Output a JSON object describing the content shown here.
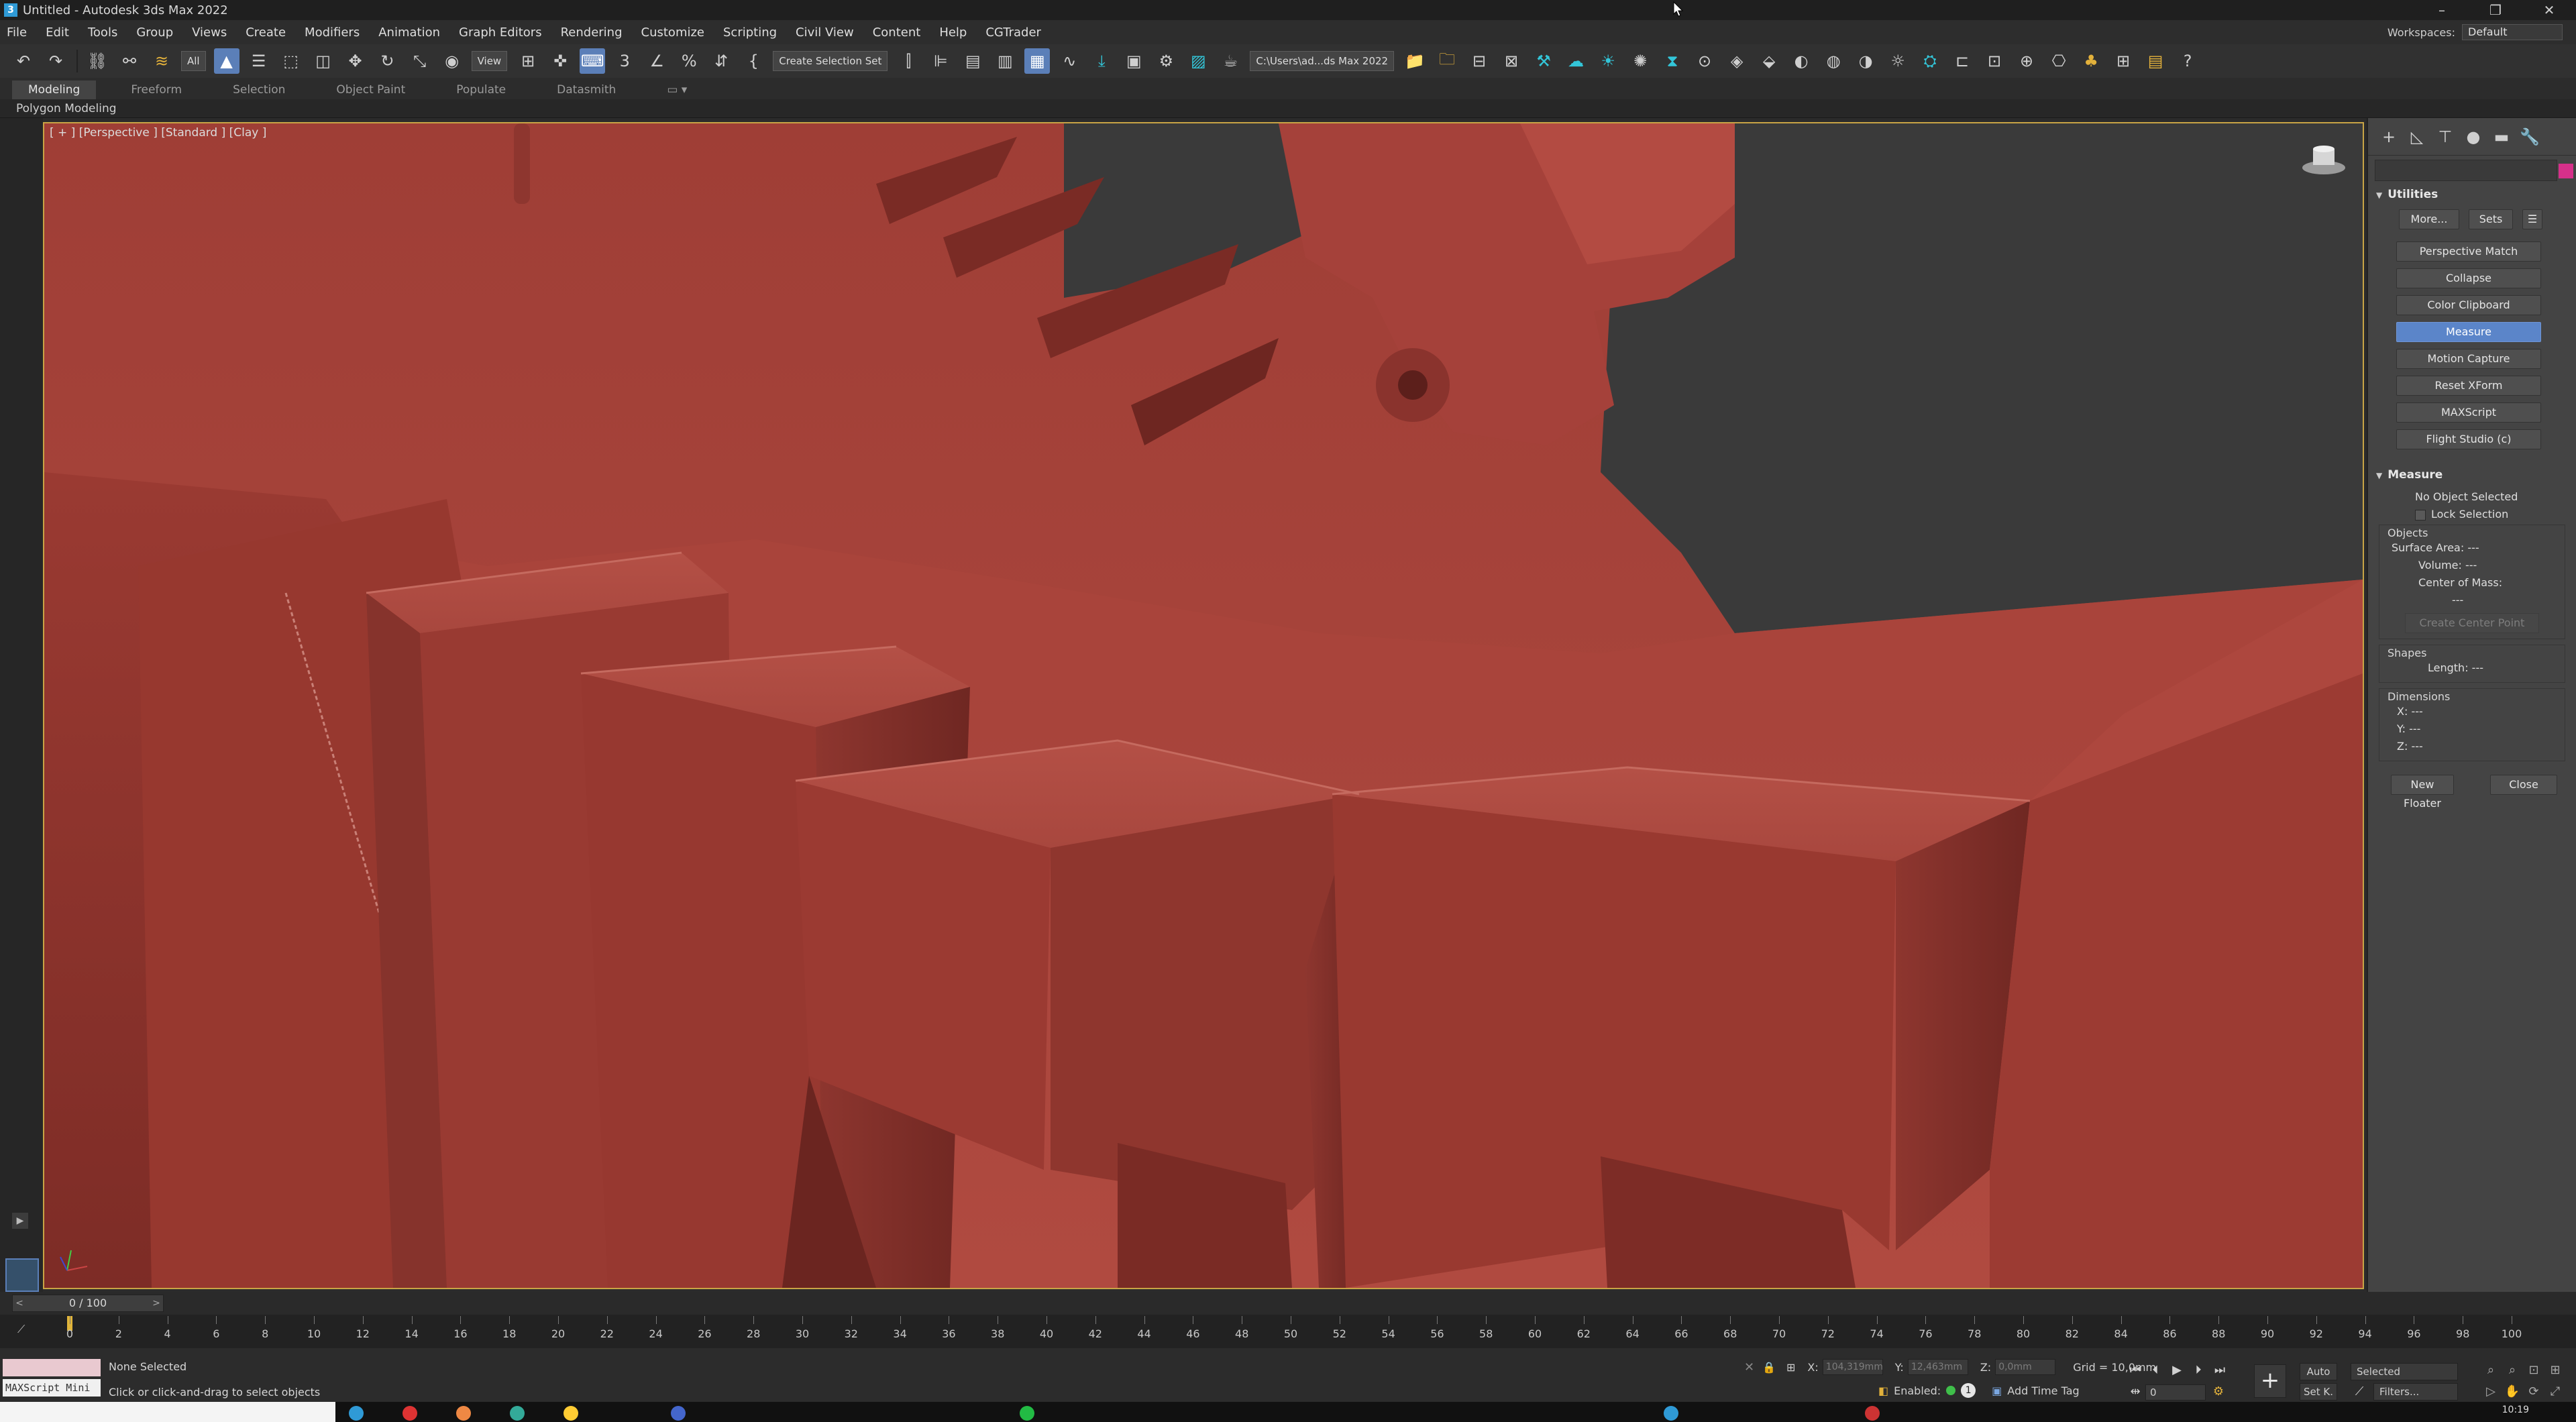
{
  "window": {
    "title": "Untitled - Autodesk 3ds Max 2022",
    "controls": [
      "–",
      "❐",
      "✕"
    ]
  },
  "menu": {
    "items": [
      "File",
      "Edit",
      "Tools",
      "Group",
      "Views",
      "Create",
      "Modifiers",
      "Animation",
      "Graph Editors",
      "Rendering",
      "Customize",
      "Scripting",
      "Civil View",
      "Content",
      "Help",
      "CGTrader"
    ],
    "workspaces_label": "Workspaces:",
    "workspace_value": "Default"
  },
  "toolbar": {
    "filter_value": "All",
    "refcoord_value": "View",
    "selection_set": "Create Selection Set",
    "project_path": "C:\\Users\\ad...ds Max 2022"
  },
  "ribbon": {
    "tabs": [
      "Modeling",
      "Freeform",
      "Selection",
      "Object Paint",
      "Populate",
      "Datasmith"
    ],
    "active_tab": "Modeling",
    "sub_label": "Polygon Modeling"
  },
  "viewport": {
    "label": "[ + ] [Perspective ] [Standard ] [Clay ]",
    "clay_color": "#a9433b",
    "background": "#3a3a3a"
  },
  "command_panel": {
    "rollout_utilities": "Utilities",
    "more_button": "More...",
    "sets_button": "Sets",
    "utilities": [
      "Perspective Match",
      "Collapse",
      "Color Clipboard",
      "Measure",
      "Motion Capture",
      "Reset XForm",
      "MAXScript",
      "Flight Studio (c)"
    ],
    "active_utility": "Measure",
    "rollout_measure": "Measure",
    "no_selection": "No Object Selected",
    "lock_selection": "Lock Selection",
    "objects_title": "Objects",
    "surface_area": "Surface Area:  ---",
    "volume": "Volume:  ---",
    "center_of_mass": "Center of Mass:",
    "center_value": "---",
    "create_center_point": "Create Center Point",
    "shapes_title": "Shapes",
    "length": "Length:  ---",
    "dimensions_title": "Dimensions",
    "dim_x": "X:  ---",
    "dim_y": "Y:  ---",
    "dim_z": "Z:  ---",
    "new_floater": "New Floater",
    "close": "Close",
    "accent_swatch": "#d6308a"
  },
  "timeline": {
    "slider_label": "0 / 100",
    "current_frame": 0,
    "ticks": [
      0,
      2,
      4,
      6,
      8,
      10,
      12,
      14,
      16,
      18,
      20,
      22,
      24,
      26,
      28,
      30,
      32,
      34,
      36,
      38,
      40,
      42,
      44,
      46,
      48,
      50,
      52,
      54,
      56,
      58,
      60,
      62,
      64,
      66,
      68,
      70,
      72,
      74,
      76,
      78,
      80,
      82,
      84,
      86,
      88,
      90,
      92,
      94,
      96,
      98,
      100
    ]
  },
  "status": {
    "maxscript_label": "MAXScript Mini",
    "selection": "None Selected",
    "prompt": "Click or click-and-drag to select objects",
    "x_label": "X:",
    "x_value": "104,319mm",
    "y_label": "Y:",
    "y_value": "12,463mm",
    "z_label": "Z:",
    "z_value": "0,0mm",
    "grid": "Grid = 10,0mm",
    "enabled_label": "Enabled:",
    "enabled_count": "1",
    "add_time_tag": "Add Time Tag",
    "auto_key": "Auto",
    "set_key": "Set K.",
    "key_mode": "Selected",
    "filters": "Filters...",
    "frame_field": "0"
  },
  "taskbar": {
    "clock": "10:19"
  }
}
